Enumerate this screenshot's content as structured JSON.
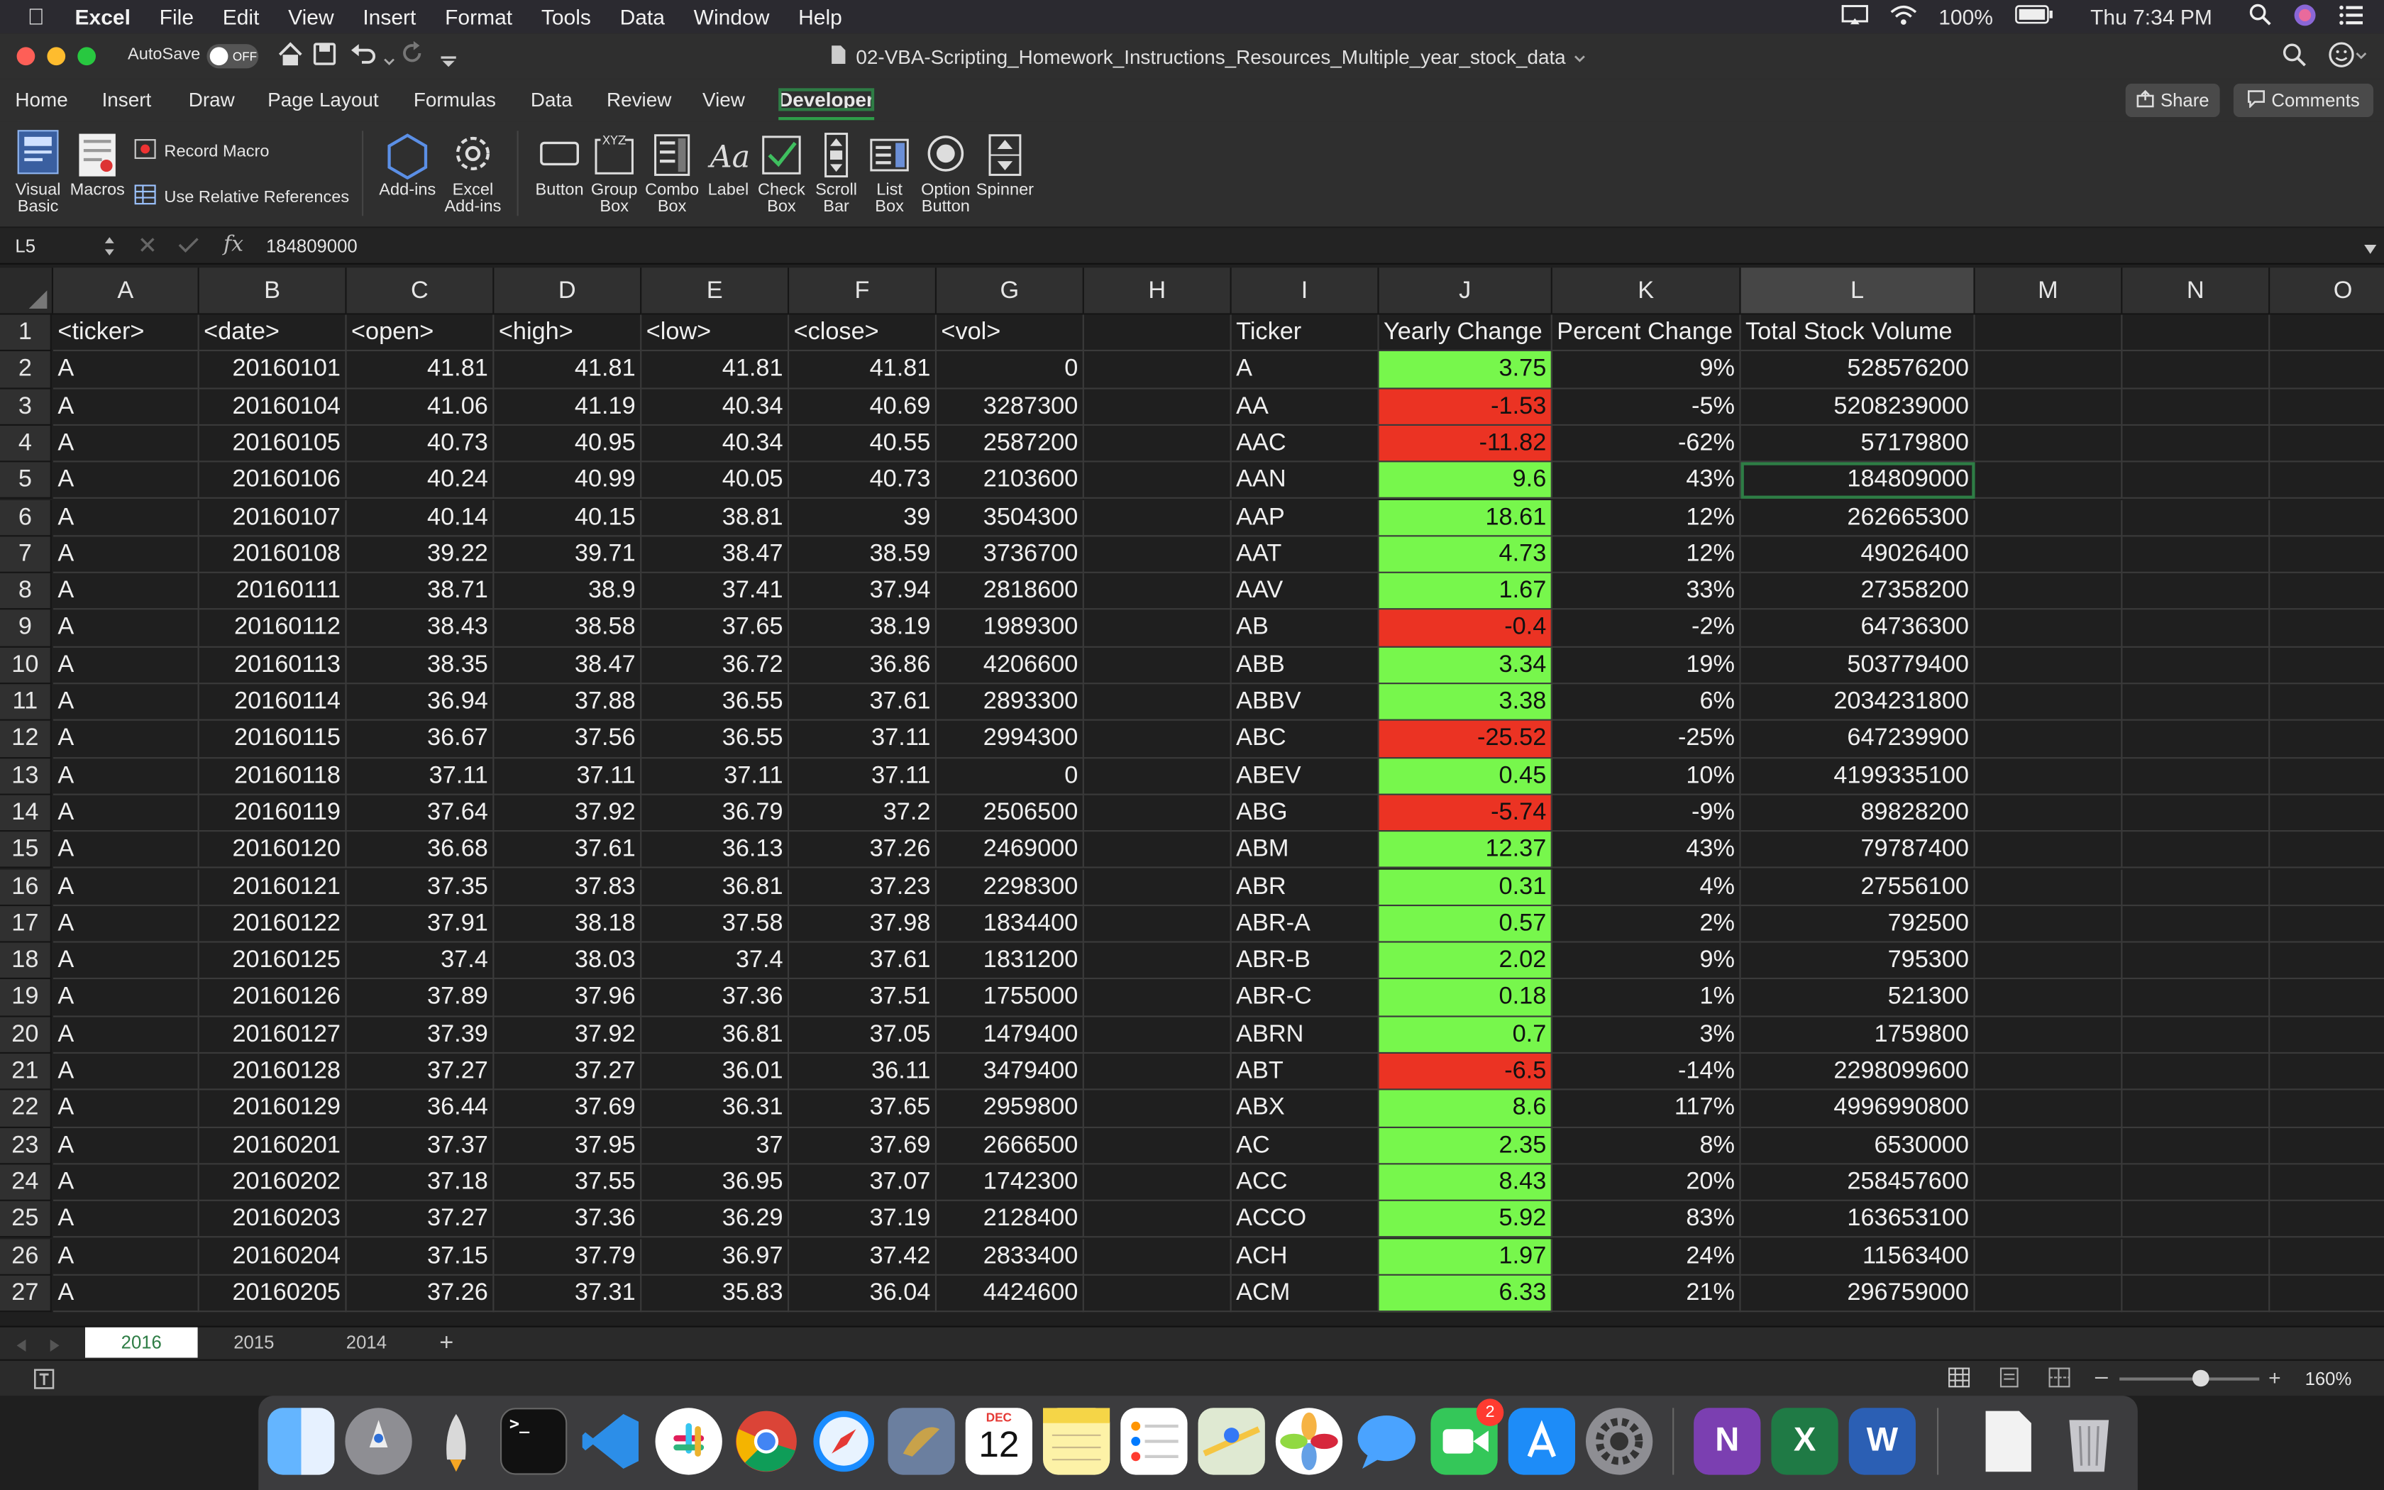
{
  "menubar": {
    "app_name": "Excel",
    "items": [
      "File",
      "Edit",
      "View",
      "Insert",
      "Format",
      "Tools",
      "Data",
      "Window",
      "Help"
    ],
    "battery": "100%",
    "clock": "Thu 7:34 PM"
  },
  "titlebar": {
    "autosave_label": "AutoSave",
    "autosave_state": "OFF",
    "document_title": "02-VBA-Scripting_Homework_Instructions_Resources_Multiple_year_stock_data"
  },
  "ribbon_tabs": [
    "Home",
    "Insert",
    "Draw",
    "Page Layout",
    "Formulas",
    "Data",
    "Review",
    "View",
    "Developer"
  ],
  "active_tab": "Developer",
  "share_label": "Share",
  "comments_label": "Comments",
  "ribbon": {
    "visual_basic": "Visual Basic",
    "macros": "Macros",
    "record_macro": "Record Macro",
    "relative_refs": "Use Relative References",
    "addins": "Add-ins",
    "excel_addins": "Excel Add-ins",
    "button": "Button",
    "group_box": "Group Box",
    "combo_box": "Combo Box",
    "label": "Label",
    "check_box": "Check Box",
    "scroll_bar": "Scroll Bar",
    "list_box": "List Box",
    "option_button": "Option Button",
    "spinner": "Spinner"
  },
  "formula_bar": {
    "name_box": "L5",
    "fx": "fx",
    "value": "184809000"
  },
  "columns": [
    "A",
    "B",
    "C",
    "D",
    "E",
    "F",
    "G",
    "H",
    "I",
    "J",
    "K",
    "L",
    "M",
    "N",
    "O"
  ],
  "header_row": [
    "<ticker>",
    "<date>",
    "<open>",
    "<high>",
    "<low>",
    "<close>",
    "<vol>",
    "",
    "Ticker",
    "Yearly Change",
    "Percent Change",
    "Total Stock Volume"
  ],
  "rows": [
    [
      "A",
      "20160101",
      "41.81",
      "41.81",
      "41.81",
      "41.81",
      "0",
      "",
      "A",
      "3.75",
      "9%",
      "528576200"
    ],
    [
      "A",
      "20160104",
      "41.06",
      "41.19",
      "40.34",
      "40.69",
      "3287300",
      "",
      "AA",
      "-1.53",
      "-5%",
      "5208239000"
    ],
    [
      "A",
      "20160105",
      "40.73",
      "40.95",
      "40.34",
      "40.55",
      "2587200",
      "",
      "AAC",
      "-11.82",
      "-62%",
      "57179800"
    ],
    [
      "A",
      "20160106",
      "40.24",
      "40.99",
      "40.05",
      "40.73",
      "2103600",
      "",
      "AAN",
      "9.6",
      "43%",
      "184809000"
    ],
    [
      "A",
      "20160107",
      "40.14",
      "40.15",
      "38.81",
      "39",
      "3504300",
      "",
      "AAP",
      "18.61",
      "12%",
      "262665300"
    ],
    [
      "A",
      "20160108",
      "39.22",
      "39.71",
      "38.47",
      "38.59",
      "3736700",
      "",
      "AAT",
      "4.73",
      "12%",
      "49026400"
    ],
    [
      "A",
      "20160111",
      "38.71",
      "38.9",
      "37.41",
      "37.94",
      "2818600",
      "",
      "AAV",
      "1.67",
      "33%",
      "27358200"
    ],
    [
      "A",
      "20160112",
      "38.43",
      "38.58",
      "37.65",
      "38.19",
      "1989300",
      "",
      "AB",
      "-0.4",
      "-2%",
      "64736300"
    ],
    [
      "A",
      "20160113",
      "38.35",
      "38.47",
      "36.72",
      "36.86",
      "4206600",
      "",
      "ABB",
      "3.34",
      "19%",
      "503779400"
    ],
    [
      "A",
      "20160114",
      "36.94",
      "37.88",
      "36.55",
      "37.61",
      "2893300",
      "",
      "ABBV",
      "3.38",
      "6%",
      "2034231800"
    ],
    [
      "A",
      "20160115",
      "36.67",
      "37.56",
      "36.55",
      "37.11",
      "2994300",
      "",
      "ABC",
      "-25.52",
      "-25%",
      "647239900"
    ],
    [
      "A",
      "20160118",
      "37.11",
      "37.11",
      "37.11",
      "37.11",
      "0",
      "",
      "ABEV",
      "0.45",
      "10%",
      "4199335100"
    ],
    [
      "A",
      "20160119",
      "37.64",
      "37.92",
      "36.79",
      "37.2",
      "2506500",
      "",
      "ABG",
      "-5.74",
      "-9%",
      "89828200"
    ],
    [
      "A",
      "20160120",
      "36.68",
      "37.61",
      "36.13",
      "37.26",
      "2469000",
      "",
      "ABM",
      "12.37",
      "43%",
      "79787400"
    ],
    [
      "A",
      "20160121",
      "37.35",
      "37.83",
      "36.81",
      "37.23",
      "2298300",
      "",
      "ABR",
      "0.31",
      "4%",
      "27556100"
    ],
    [
      "A",
      "20160122",
      "37.91",
      "38.18",
      "37.58",
      "37.98",
      "1834400",
      "",
      "ABR-A",
      "0.57",
      "2%",
      "792500"
    ],
    [
      "A",
      "20160125",
      "37.4",
      "38.03",
      "37.4",
      "37.61",
      "1831200",
      "",
      "ABR-B",
      "2.02",
      "9%",
      "795300"
    ],
    [
      "A",
      "20160126",
      "37.89",
      "37.96",
      "37.36",
      "37.51",
      "1755000",
      "",
      "ABR-C",
      "0.18",
      "1%",
      "521300"
    ],
    [
      "A",
      "20160127",
      "37.39",
      "37.92",
      "36.81",
      "37.05",
      "1479400",
      "",
      "ABRN",
      "0.7",
      "3%",
      "1759800"
    ],
    [
      "A",
      "20160128",
      "37.27",
      "37.27",
      "36.01",
      "36.11",
      "3479400",
      "",
      "ABT",
      "-6.5",
      "-14%",
      "2298099600"
    ],
    [
      "A",
      "20160129",
      "36.44",
      "37.69",
      "36.31",
      "37.65",
      "2959800",
      "",
      "ABX",
      "8.6",
      "117%",
      "4996990800"
    ],
    [
      "A",
      "20160201",
      "37.37",
      "37.95",
      "37",
      "37.69",
      "2666500",
      "",
      "AC",
      "2.35",
      "8%",
      "6530000"
    ],
    [
      "A",
      "20160202",
      "37.18",
      "37.55",
      "36.95",
      "37.07",
      "1742300",
      "",
      "ACC",
      "8.43",
      "20%",
      "258457600"
    ],
    [
      "A",
      "20160203",
      "37.27",
      "37.36",
      "36.29",
      "37.19",
      "2128400",
      "",
      "ACCO",
      "5.92",
      "83%",
      "163653100"
    ],
    [
      "A",
      "20160204",
      "37.15",
      "37.79",
      "36.97",
      "37.42",
      "2833400",
      "",
      "ACH",
      "1.97",
      "24%",
      "11563400"
    ],
    [
      "A",
      "20160205",
      "37.26",
      "37.31",
      "35.83",
      "36.04",
      "4424600",
      "",
      "ACM",
      "6.33",
      "21%",
      "296759000"
    ]
  ],
  "sheet_tabs": [
    "2016",
    "2015",
    "2014"
  ],
  "active_sheet": "2016",
  "status": {
    "zoom": "160%"
  },
  "dock": {
    "calendar_month": "DEC",
    "calendar_day": "12",
    "facetime_badge": "2"
  },
  "colors": {
    "positive_fill": "#77f74c",
    "negative_fill": "#eb3323",
    "accent": "#2e7d45"
  }
}
